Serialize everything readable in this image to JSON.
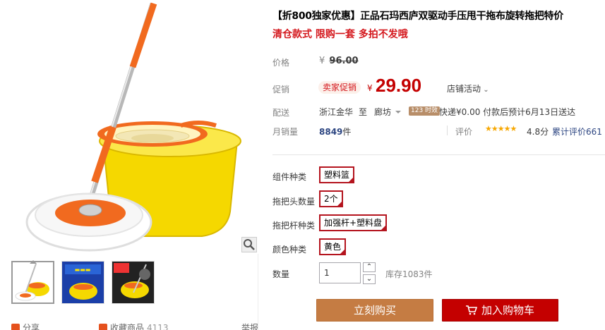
{
  "product": {
    "title": "【折800独家优惠】正品石玛西庐双驱动手压甩干拖布旋转拖把特价",
    "subtitle": "清仓款式 限购一套 多拍不发哦"
  },
  "price": {
    "label": "价格",
    "currency": "¥",
    "original": "96.00"
  },
  "promo": {
    "label": "促销",
    "tag": "卖家促销",
    "currency": "¥",
    "price": "29.90",
    "shop_activity": "店铺活动"
  },
  "shipping": {
    "label": "配送",
    "from": "浙江金华",
    "to_prefix": "至",
    "to": "廊坊",
    "badge": "123 时效",
    "info": "快递¥0.00 付款后预计6月13日送达"
  },
  "sales": {
    "label": "月销量",
    "count": "8849",
    "unit": "件",
    "rating_label": "评价",
    "stars": "★★★★★",
    "rating_value": 4.8,
    "score": "4.8分",
    "reviews": "累计评价661"
  },
  "skus": [
    {
      "label": "组件种类",
      "value": "塑料篮"
    },
    {
      "label": "拖把头数量",
      "value": "2个"
    },
    {
      "label": "拖把杆种类",
      "value": "加强杆+塑料盘"
    },
    {
      "label": "颜色种类",
      "value": "黄色"
    }
  ],
  "quantity": {
    "label": "数量",
    "value": "1",
    "up": "⌃",
    "down": "⌄",
    "stock": "库存1083件"
  },
  "actions": {
    "buy_now": "立刻购买",
    "add_to_cart": "加入购物车"
  },
  "gallery": {
    "share": "分享",
    "favorite": "收藏商品",
    "favorite_count": "4113",
    "report": "举报"
  },
  "colors": {
    "accent": "#c40000",
    "buy": "#c57c43",
    "sku_border": "#b4141e",
    "star": "#f7a700"
  }
}
